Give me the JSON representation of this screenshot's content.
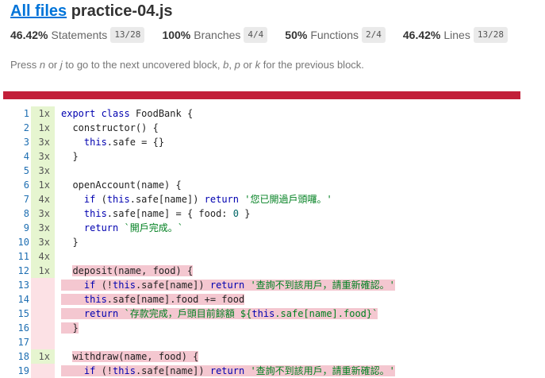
{
  "header": {
    "all_files_link": "All files",
    "filename": "practice-04.js"
  },
  "summary": [
    {
      "pct": "46.42%",
      "label": "Statements",
      "fraction": "13/28"
    },
    {
      "pct": "100%",
      "label": "Branches",
      "fraction": "4/4"
    },
    {
      "pct": "50%",
      "label": "Functions",
      "fraction": "2/4"
    },
    {
      "pct": "46.42%",
      "label": "Lines",
      "fraction": "13/28"
    }
  ],
  "help": {
    "p1": "Press ",
    "k1": "n",
    "p2": " or ",
    "k2": "j",
    "p3": " to go to the next uncovered block, ",
    "k3": "b",
    "p4": ", ",
    "k4": "p",
    "p5": " or ",
    "k5": "k",
    "p6": " for the previous block."
  },
  "colors": {
    "status_bar": "#c21f39",
    "covered_gutter": "#e6f5d0",
    "uncovered_gutter": "#fce1e5",
    "uncovered_highlight": "#f4c7d0",
    "link": "#0074d9"
  },
  "lines": [
    {
      "num": "1",
      "hits": "1x",
      "covered": true,
      "hl": false,
      "code": [
        [
          "kw",
          "export "
        ],
        [
          "kw",
          "class "
        ],
        [
          "t",
          "FoodBank {"
        ]
      ]
    },
    {
      "num": "2",
      "hits": "1x",
      "covered": true,
      "hl": false,
      "code": [
        [
          "t",
          "  constructor() {"
        ]
      ]
    },
    {
      "num": "3",
      "hits": "3x",
      "covered": true,
      "hl": false,
      "code": [
        [
          "this",
          "    this"
        ],
        [
          "t",
          ".safe = {}"
        ]
      ]
    },
    {
      "num": "4",
      "hits": "3x",
      "covered": true,
      "hl": false,
      "code": [
        [
          "t",
          "  }"
        ]
      ]
    },
    {
      "num": "5",
      "hits": "3x",
      "covered": true,
      "hl": false,
      "code": []
    },
    {
      "num": "6",
      "hits": "1x",
      "covered": true,
      "hl": false,
      "code": [
        [
          "t",
          "  openAccount(name) {"
        ]
      ]
    },
    {
      "num": "7",
      "hits": "4x",
      "covered": true,
      "hl": false,
      "code": [
        [
          "kw",
          "    if "
        ],
        [
          "t",
          "("
        ],
        [
          "this",
          "this"
        ],
        [
          "t",
          ".safe[name]) "
        ],
        [
          "kw",
          "return "
        ],
        [
          "str",
          "'您已開過戶頭囉。'"
        ]
      ]
    },
    {
      "num": "8",
      "hits": "3x",
      "covered": true,
      "hl": false,
      "code": [
        [
          "this",
          "    this"
        ],
        [
          "t",
          ".safe[name] = { food: "
        ],
        [
          "num",
          "0"
        ],
        [
          "t",
          " }"
        ]
      ]
    },
    {
      "num": "9",
      "hits": "3x",
      "covered": true,
      "hl": false,
      "code": [
        [
          "kw",
          "    return "
        ],
        [
          "str",
          "`開戶完成。`"
        ]
      ]
    },
    {
      "num": "10",
      "hits": "3x",
      "covered": true,
      "hl": false,
      "code": [
        [
          "t",
          "  }"
        ]
      ]
    },
    {
      "num": "11",
      "hits": "4x",
      "covered": true,
      "hl": false,
      "code": []
    },
    {
      "num": "12",
      "hits": "1x",
      "covered": true,
      "hl": false,
      "code": [
        [
          "t",
          "  "
        ],
        [
          "hl",
          "deposit(name, food) {"
        ]
      ]
    },
    {
      "num": "13",
      "hits": "",
      "covered": false,
      "hl": true,
      "code": [
        [
          "kw",
          "    if "
        ],
        [
          "t",
          "(!"
        ],
        [
          "this",
          "this"
        ],
        [
          "t",
          ".safe[name]) "
        ],
        [
          "kw",
          "return "
        ],
        [
          "str",
          "'查詢不到該用戶，請重新確認。'"
        ]
      ]
    },
    {
      "num": "14",
      "hits": "",
      "covered": false,
      "hl": true,
      "code": [
        [
          "this",
          "    this"
        ],
        [
          "t",
          ".safe[name].food += food"
        ]
      ]
    },
    {
      "num": "15",
      "hits": "",
      "covered": false,
      "hl": true,
      "code": [
        [
          "kw",
          "    return "
        ],
        [
          "str",
          "`存款完成，戶頭目前餘額 ${"
        ],
        [
          "this",
          "this"
        ],
        [
          "str",
          ".safe[name].food}`"
        ]
      ]
    },
    {
      "num": "16",
      "hits": "",
      "covered": false,
      "hl": true,
      "code": [
        [
          "t",
          "  }"
        ]
      ]
    },
    {
      "num": "17",
      "hits": "",
      "covered": false,
      "hl": false,
      "code": []
    },
    {
      "num": "18",
      "hits": "1x",
      "covered": true,
      "hl": false,
      "code": [
        [
          "t",
          "  "
        ],
        [
          "hl",
          "withdraw(name, food) {"
        ]
      ]
    },
    {
      "num": "19",
      "hits": "",
      "covered": false,
      "hl": true,
      "code": [
        [
          "kw",
          "    if "
        ],
        [
          "t",
          "(!"
        ],
        [
          "this",
          "this"
        ],
        [
          "t",
          ".safe[name]) "
        ],
        [
          "kw",
          "return "
        ],
        [
          "str",
          "'查詢不到該用戶，請重新確認。'"
        ]
      ]
    }
  ]
}
